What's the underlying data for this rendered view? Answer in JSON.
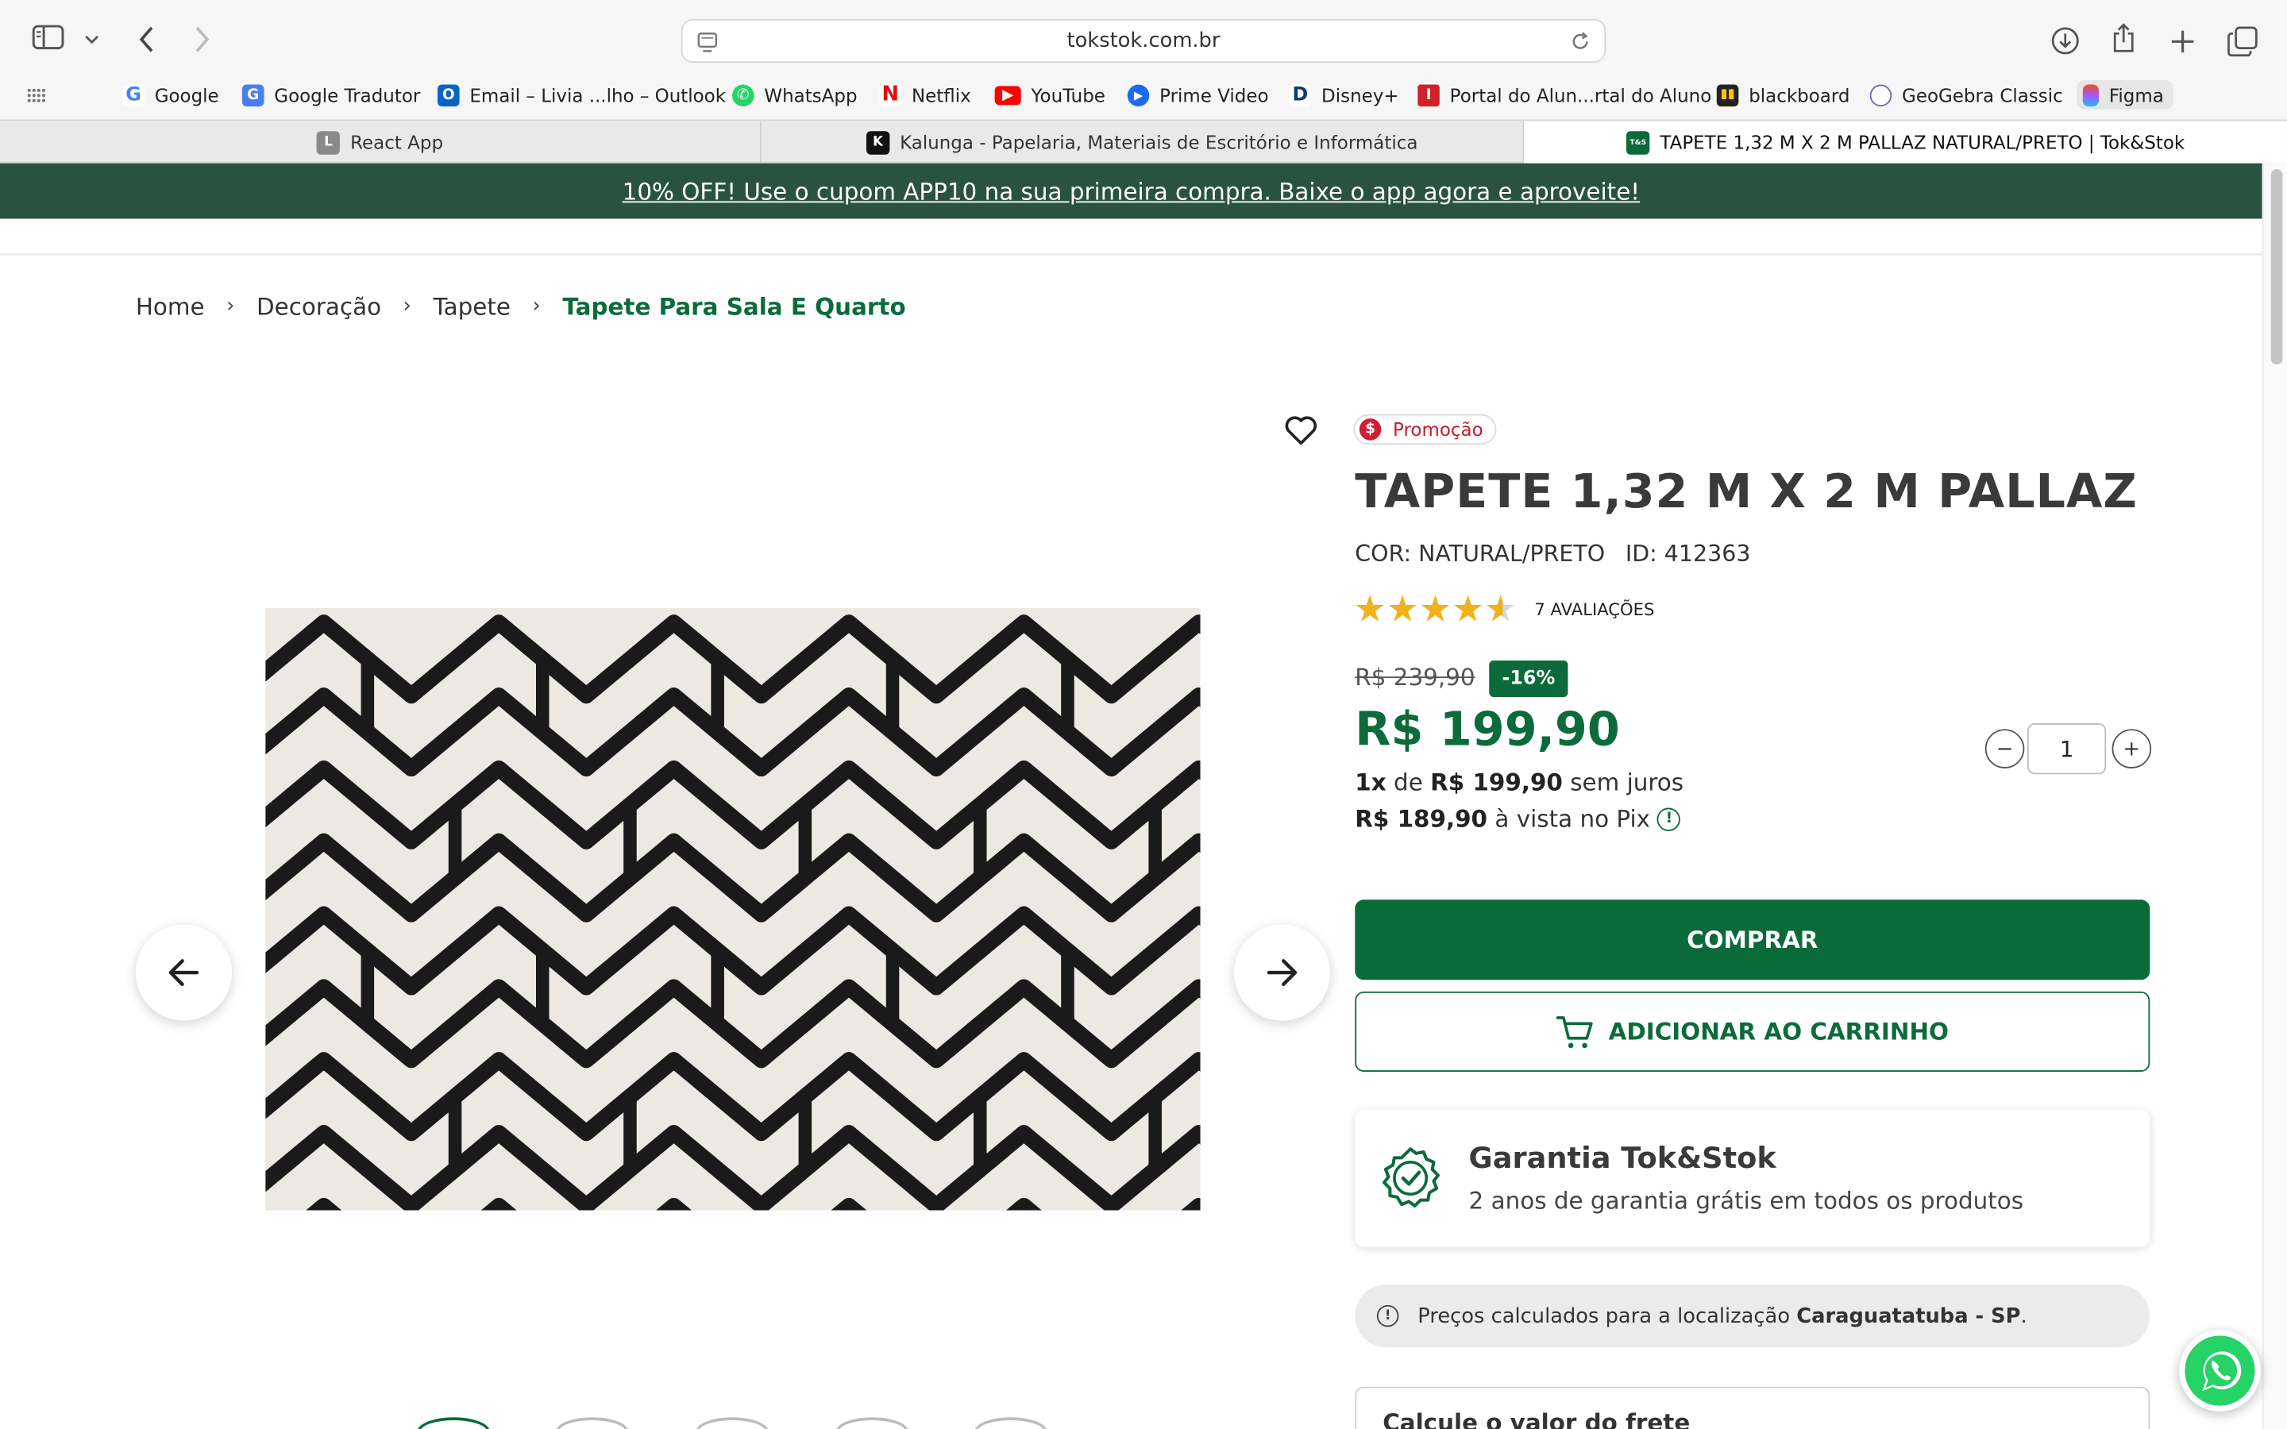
{
  "browser": {
    "url": "tokstok.com.br",
    "bookmarks": [
      {
        "label": "Google",
        "icon": "google-icon",
        "color": "#4285f4"
      },
      {
        "label": "Google Tradutor",
        "icon": "google-translate-icon",
        "color": "#4a7df0"
      },
      {
        "label": "Email – Livia ...lho – Outlook",
        "icon": "outlook-icon",
        "color": "#0a64c8"
      },
      {
        "label": "WhatsApp",
        "icon": "whatsapp-icon",
        "color": "#25d366"
      },
      {
        "label": "Netflix",
        "icon": "netflix-icon",
        "color": "#e50914"
      },
      {
        "label": "YouTube",
        "icon": "youtube-icon",
        "color": "#ff0000"
      },
      {
        "label": "Prime Video",
        "icon": "prime-video-icon",
        "color": "#1a6bf0"
      },
      {
        "label": "Disney+",
        "icon": "disney-plus-icon",
        "color": "#0e3a73"
      },
      {
        "label": "Portal do Alun...rtal do Aluno",
        "icon": "portal-icon",
        "color": "#d0202a"
      },
      {
        "label": "blackboard",
        "icon": "blackboard-icon",
        "color": "#222222"
      },
      {
        "label": "GeoGebra Classic",
        "icon": "geogebra-icon",
        "color": "#6b68b5"
      },
      {
        "label": "Figma",
        "icon": "figma-icon",
        "color": "#f24e1e"
      }
    ],
    "tabs": [
      {
        "label": "React App",
        "icon": "react-app-icon",
        "fav_text": "L"
      },
      {
        "label": "Kalunga - Papelaria, Materiais de Escritório e Informática",
        "icon": "kalunga-icon",
        "fav_text": "K"
      },
      {
        "label": "TAPETE 1,32 M X 2 M PALLAZ NATURAL/PRETO | Tok&Stok",
        "icon": "tokstok-icon",
        "fav_text": "T&S"
      }
    ]
  },
  "promo_banner": "10% OFF! Use o cupom APP10 na sua primeira compra. Baixe o app agora e aproveite!",
  "breadcrumb": [
    "Home",
    "Decoração",
    "Tapete",
    "Tapete Para Sala E Quarto"
  ],
  "product": {
    "badge": "Promoção",
    "title": "TAPETE 1,32 M X 2 M PALLAZ",
    "color_label": "COR: NATURAL/PRETO",
    "id_label": "ID: 412363",
    "rating": 4.5,
    "rating_max": 5,
    "reviews": "7 AVALIAÇÕES",
    "old_price": "R$ 239,90",
    "discount": "-16%",
    "price": "R$ 199,90",
    "installment_count": "1x",
    "installment_mid": "de",
    "installment_value": "R$ 199,90",
    "installment_suffix": "sem juros",
    "pix_value": "R$ 189,90",
    "pix_suffix": "à vista no Pix",
    "quantity": "1",
    "qty_minus": "−",
    "qty_plus": "+",
    "buy_label": "COMPRAR",
    "cart_label": "ADICIONAR AO CARRINHO"
  },
  "warranty": {
    "title": "Garantia Tok&Stok",
    "text": "2 anos de garantia grátis em todos os produtos"
  },
  "location": {
    "prefix": "Preços calculados para a localização",
    "city": "Caraguatatuba - SP",
    "suffix": "."
  },
  "freight": {
    "title": "Calcule o valor do frete"
  },
  "colors": {
    "brand_green": "#0a6a3a",
    "promo_bar": "#2a5240",
    "sale_red": "#d01f35",
    "star": "#f1b01c"
  }
}
